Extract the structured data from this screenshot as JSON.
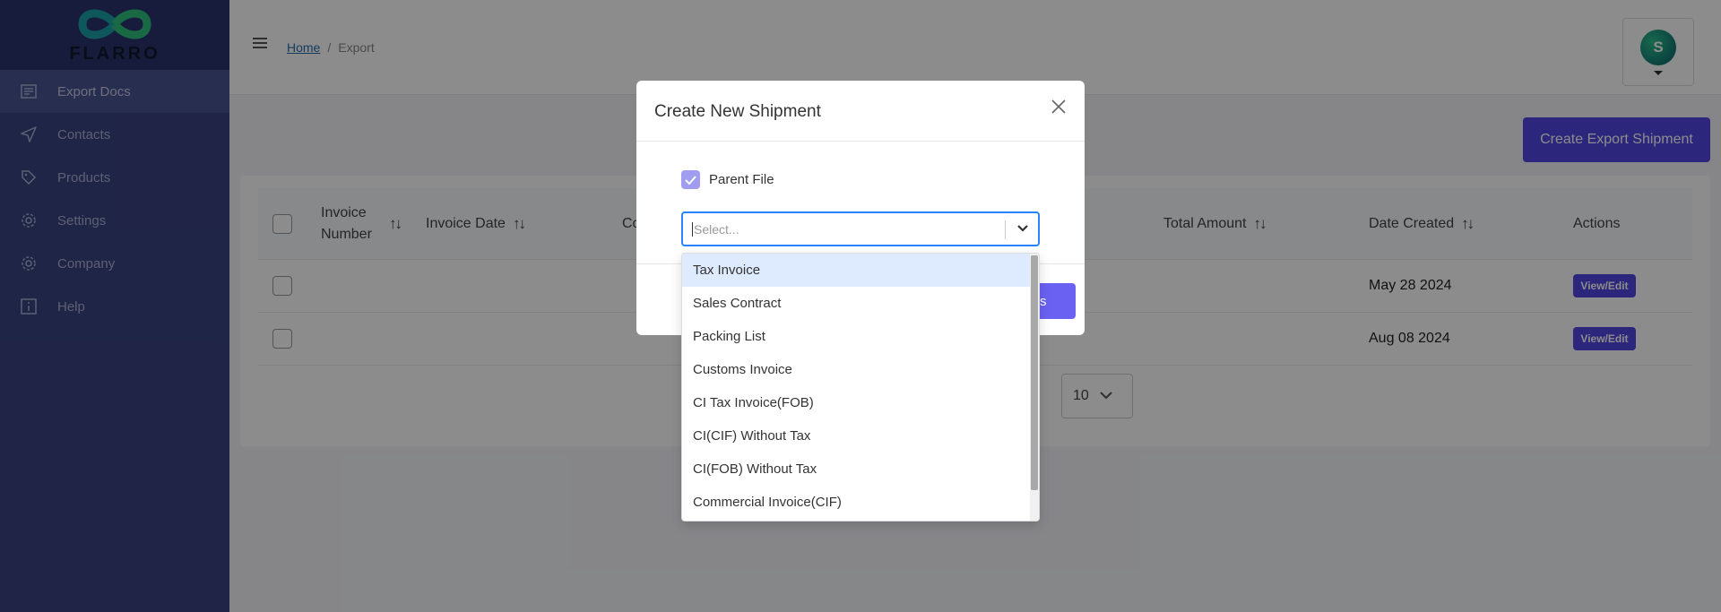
{
  "brand": {
    "logo_text": "FLARRO"
  },
  "sidebar": {
    "items": [
      {
        "label": "Export Docs",
        "icon": "document-icon"
      },
      {
        "label": "Contacts",
        "icon": "send-icon"
      },
      {
        "label": "Products",
        "icon": "tag-icon"
      },
      {
        "label": "Settings",
        "icon": "gear-icon"
      },
      {
        "label": "Company",
        "icon": "gear-icon"
      },
      {
        "label": "Help",
        "icon": "info-icon"
      }
    ]
  },
  "header": {
    "breadcrumb_home": "Home",
    "breadcrumb_sep": "/",
    "breadcrumb_current": "Export",
    "avatar_initial": "S"
  },
  "main": {
    "create_button": "Create Export Shipment",
    "table": {
      "headers": {
        "invoice_number": "Invoice Number",
        "invoice_date": "Invoice Date",
        "consignee_partial": "Co",
        "total_amount": "Total Amount",
        "date_created": "Date Created",
        "actions": "Actions"
      },
      "rows": [
        {
          "date_created": "May 28 2024",
          "action": "View/Edit"
        },
        {
          "date_created": "Aug 08 2024",
          "action": "View/Edit"
        }
      ]
    },
    "page_size": "10"
  },
  "modal": {
    "title": "Create New Shipment",
    "parent_file_label": "Parent File",
    "parent_file_checked": true,
    "select_placeholder": "Select...",
    "save_partial": "s",
    "options": [
      "Tax Invoice",
      "Sales Contract",
      "Packing List",
      "Customs Invoice",
      "CI Tax Invoice(FOB)",
      "CI(CIF) Without Tax",
      "CI(FOB) Without Tax",
      "Commercial Invoice(CIF)"
    ]
  },
  "colors": {
    "sidebar": "#3a4481",
    "primary": "#5046e4",
    "focus": "#2684ff"
  }
}
